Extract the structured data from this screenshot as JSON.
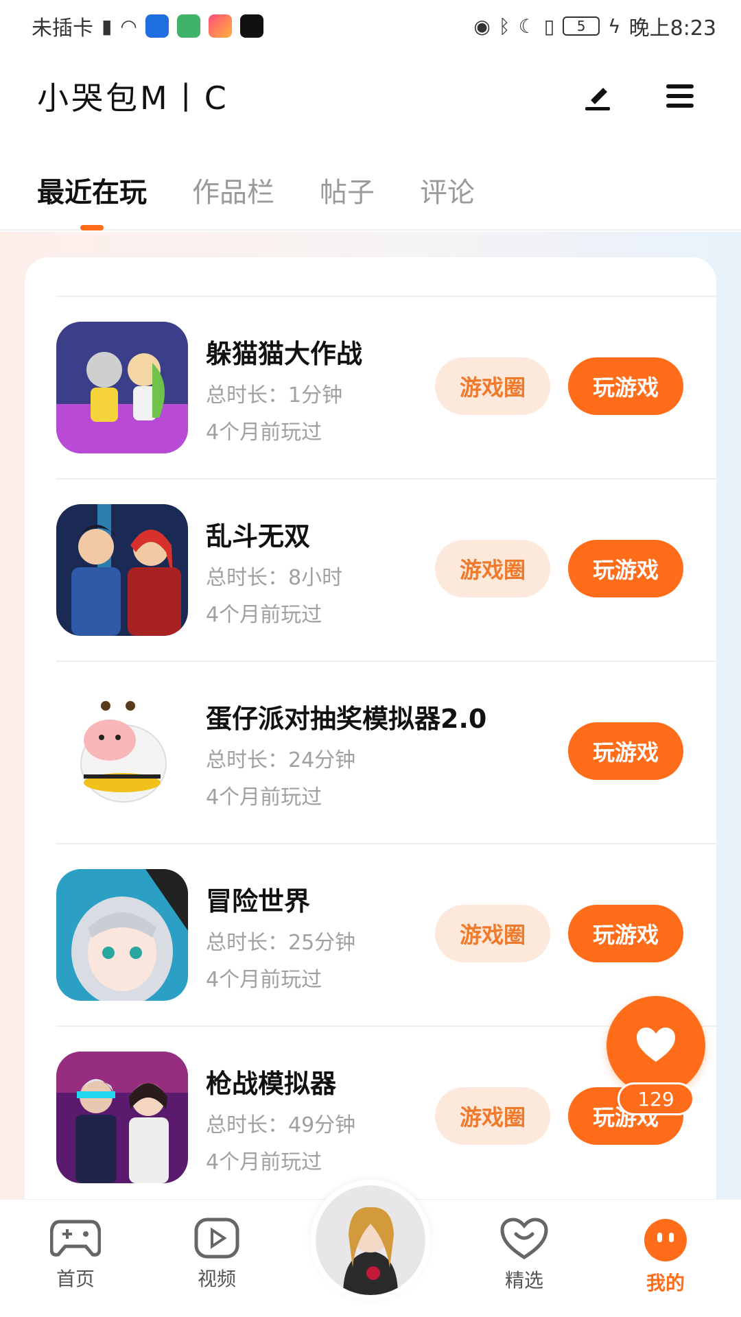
{
  "status_bar": {
    "carrier": "未插卡",
    "battery": "5",
    "time": "晚上8:23"
  },
  "header": {
    "title": "小哭包M丨C",
    "actions": [
      "edit-icon",
      "menu-icon"
    ]
  },
  "tabs": [
    {
      "label": "最近在玩",
      "active": true
    },
    {
      "label": "作品栏",
      "active": false
    },
    {
      "label": "帖子",
      "active": false
    },
    {
      "label": "评论",
      "active": false
    }
  ],
  "games": [
    {
      "name": "躲猫猫大作战",
      "duration": "总时长：1分钟",
      "last_played": "4个月前玩过",
      "circle_label": "游戏圈",
      "play_label": "玩游戏",
      "has_circle": true
    },
    {
      "name": "乱斗无双",
      "duration": "总时长：8小时",
      "last_played": "4个月前玩过",
      "circle_label": "游戏圈",
      "play_label": "玩游戏",
      "has_circle": true
    },
    {
      "name": "蛋仔派对抽奖模拟器2.0",
      "duration": "总时长：24分钟",
      "last_played": "4个月前玩过",
      "circle_label": "",
      "play_label": "玩游戏",
      "has_circle": false
    },
    {
      "name": "冒险世界",
      "duration": "总时长：25分钟",
      "last_played": "4个月前玩过",
      "circle_label": "游戏圈",
      "play_label": "玩游戏",
      "has_circle": true
    },
    {
      "name": "枪战模拟器",
      "duration": "总时长：49分钟",
      "last_played": "4个月前玩过",
      "circle_label": "游戏圈",
      "play_label": "玩游戏",
      "has_circle": true
    }
  ],
  "fab": {
    "icon": "heart-icon",
    "count": "129"
  },
  "bottom_nav": [
    {
      "label": "首页",
      "icon": "gamepad-icon",
      "active": false
    },
    {
      "label": "视频",
      "icon": "video-icon",
      "active": false
    },
    {
      "label": "精选",
      "icon": "heart-chat-icon",
      "active": false
    },
    {
      "label": "我的",
      "icon": "face-icon",
      "active": true
    }
  ],
  "colors": {
    "accent": "#ff6d1a",
    "circle_bg": "#fde9dc",
    "circle_text": "#f07a2c"
  }
}
